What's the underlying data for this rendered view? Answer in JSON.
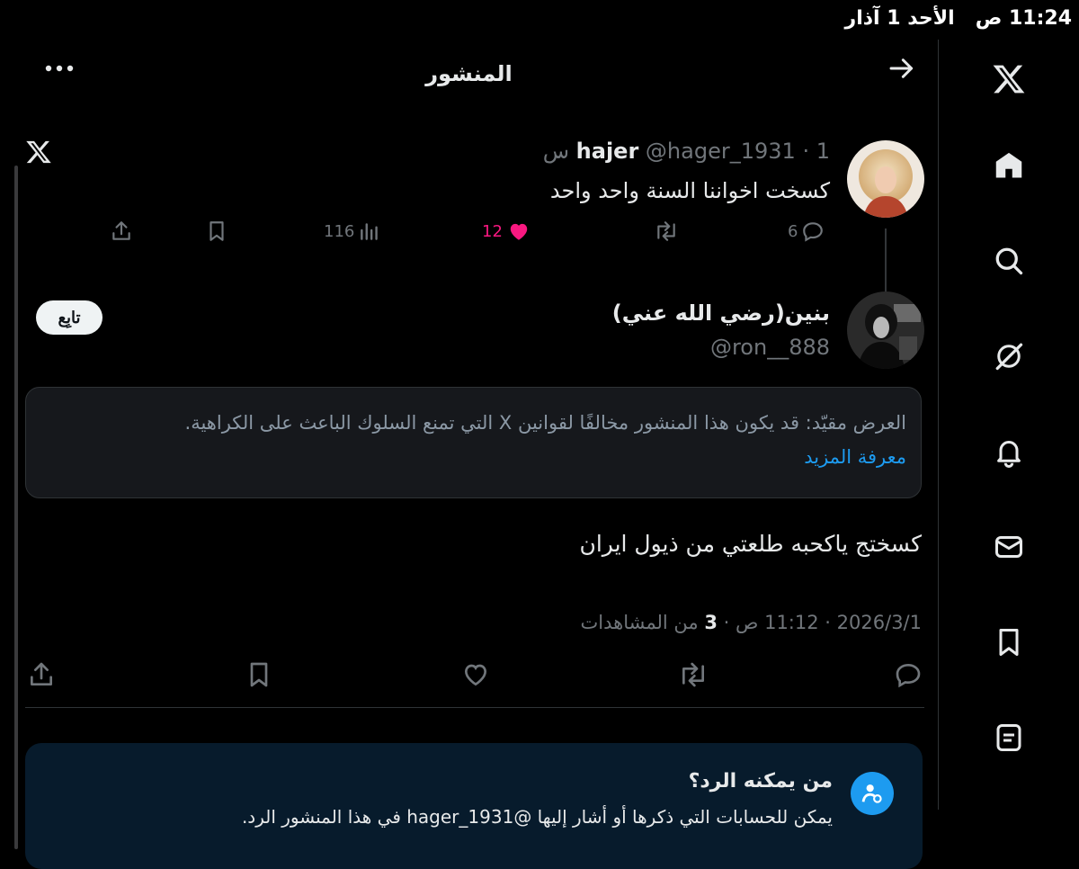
{
  "status_bar": {
    "time": "11:24",
    "period": "ص",
    "date": "الأحد 1 آذار"
  },
  "header": {
    "title": "المنشور"
  },
  "tweet1": {
    "name": "hajer",
    "handle": "@hager_1931",
    "time": "1 س",
    "text": "كسخت اخواننا السنة واحد واحد",
    "replies": "6",
    "likes": "12",
    "views": "116"
  },
  "tweet2": {
    "author_name": "بنين(رضي الله عني)",
    "author_handle": "@ron__888",
    "follow_label": "تابِع",
    "notice_text": "العرض مقيّد: قد يكون هذا المنشور مخالفًا لقوانين X التي تمنع السلوك الباعث على الكراهية.",
    "notice_link": "معرفة المزيد",
    "text": "كسختج ياكحبه طلعتي من ذيول ايران",
    "date": "2026/3/1",
    "time": "11:12 ص",
    "views_count": "3",
    "views_label": "من المشاهدات"
  },
  "reply_card": {
    "title": "من يمكنه الرد؟",
    "body": "يمكن للحسابات التي ذكرها أو أشار إليها @hager_1931 في هذا المنشور الرد."
  },
  "colors": {
    "like": "#f91880",
    "link": "#1d9bf0",
    "muted": "#71767b"
  },
  "icons": {
    "sidebar": [
      "x-logo-icon",
      "home-icon",
      "search-icon",
      "grok-icon",
      "bell-icon",
      "mail-icon",
      "bookmark-icon",
      "list-icon"
    ]
  }
}
